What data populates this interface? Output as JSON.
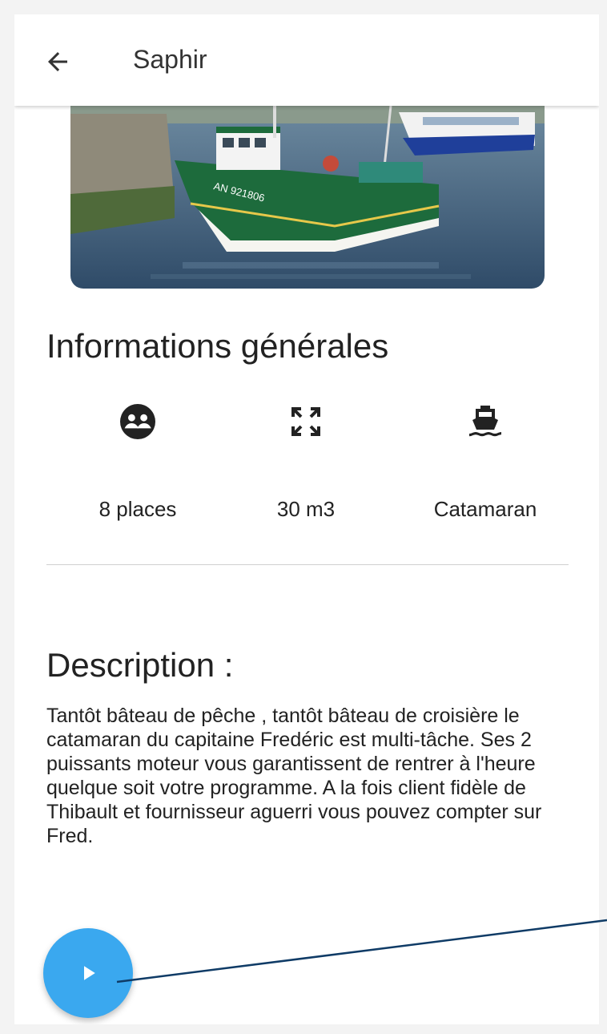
{
  "appbar": {
    "title": "Saphir"
  },
  "info": {
    "section_title": "Informations générales",
    "stats": [
      {
        "icon": "people-icon",
        "label": "8 places"
      },
      {
        "icon": "expand-icon",
        "label": "30 m3"
      },
      {
        "icon": "boat-icon",
        "label": "Catamaran"
      }
    ]
  },
  "description": {
    "section_title": "Description :",
    "text": "Tantôt bâteau de pêche , tantôt bâteau de croisière le catamaran du capitaine Fredéric est multi-tâche. Ses 2 puissants moteur vous garantissent de rentrer à l'heure quelque soit votre programme. A la fois client fidèle de Thibault et fournisseur aguerri vous pouvez compter sur Fred."
  },
  "colors": {
    "fab": "#3aa8ef",
    "pointer_line": "#0f3b66"
  },
  "icons": {
    "back": "arrow-left-icon",
    "fab": "play-icon"
  }
}
